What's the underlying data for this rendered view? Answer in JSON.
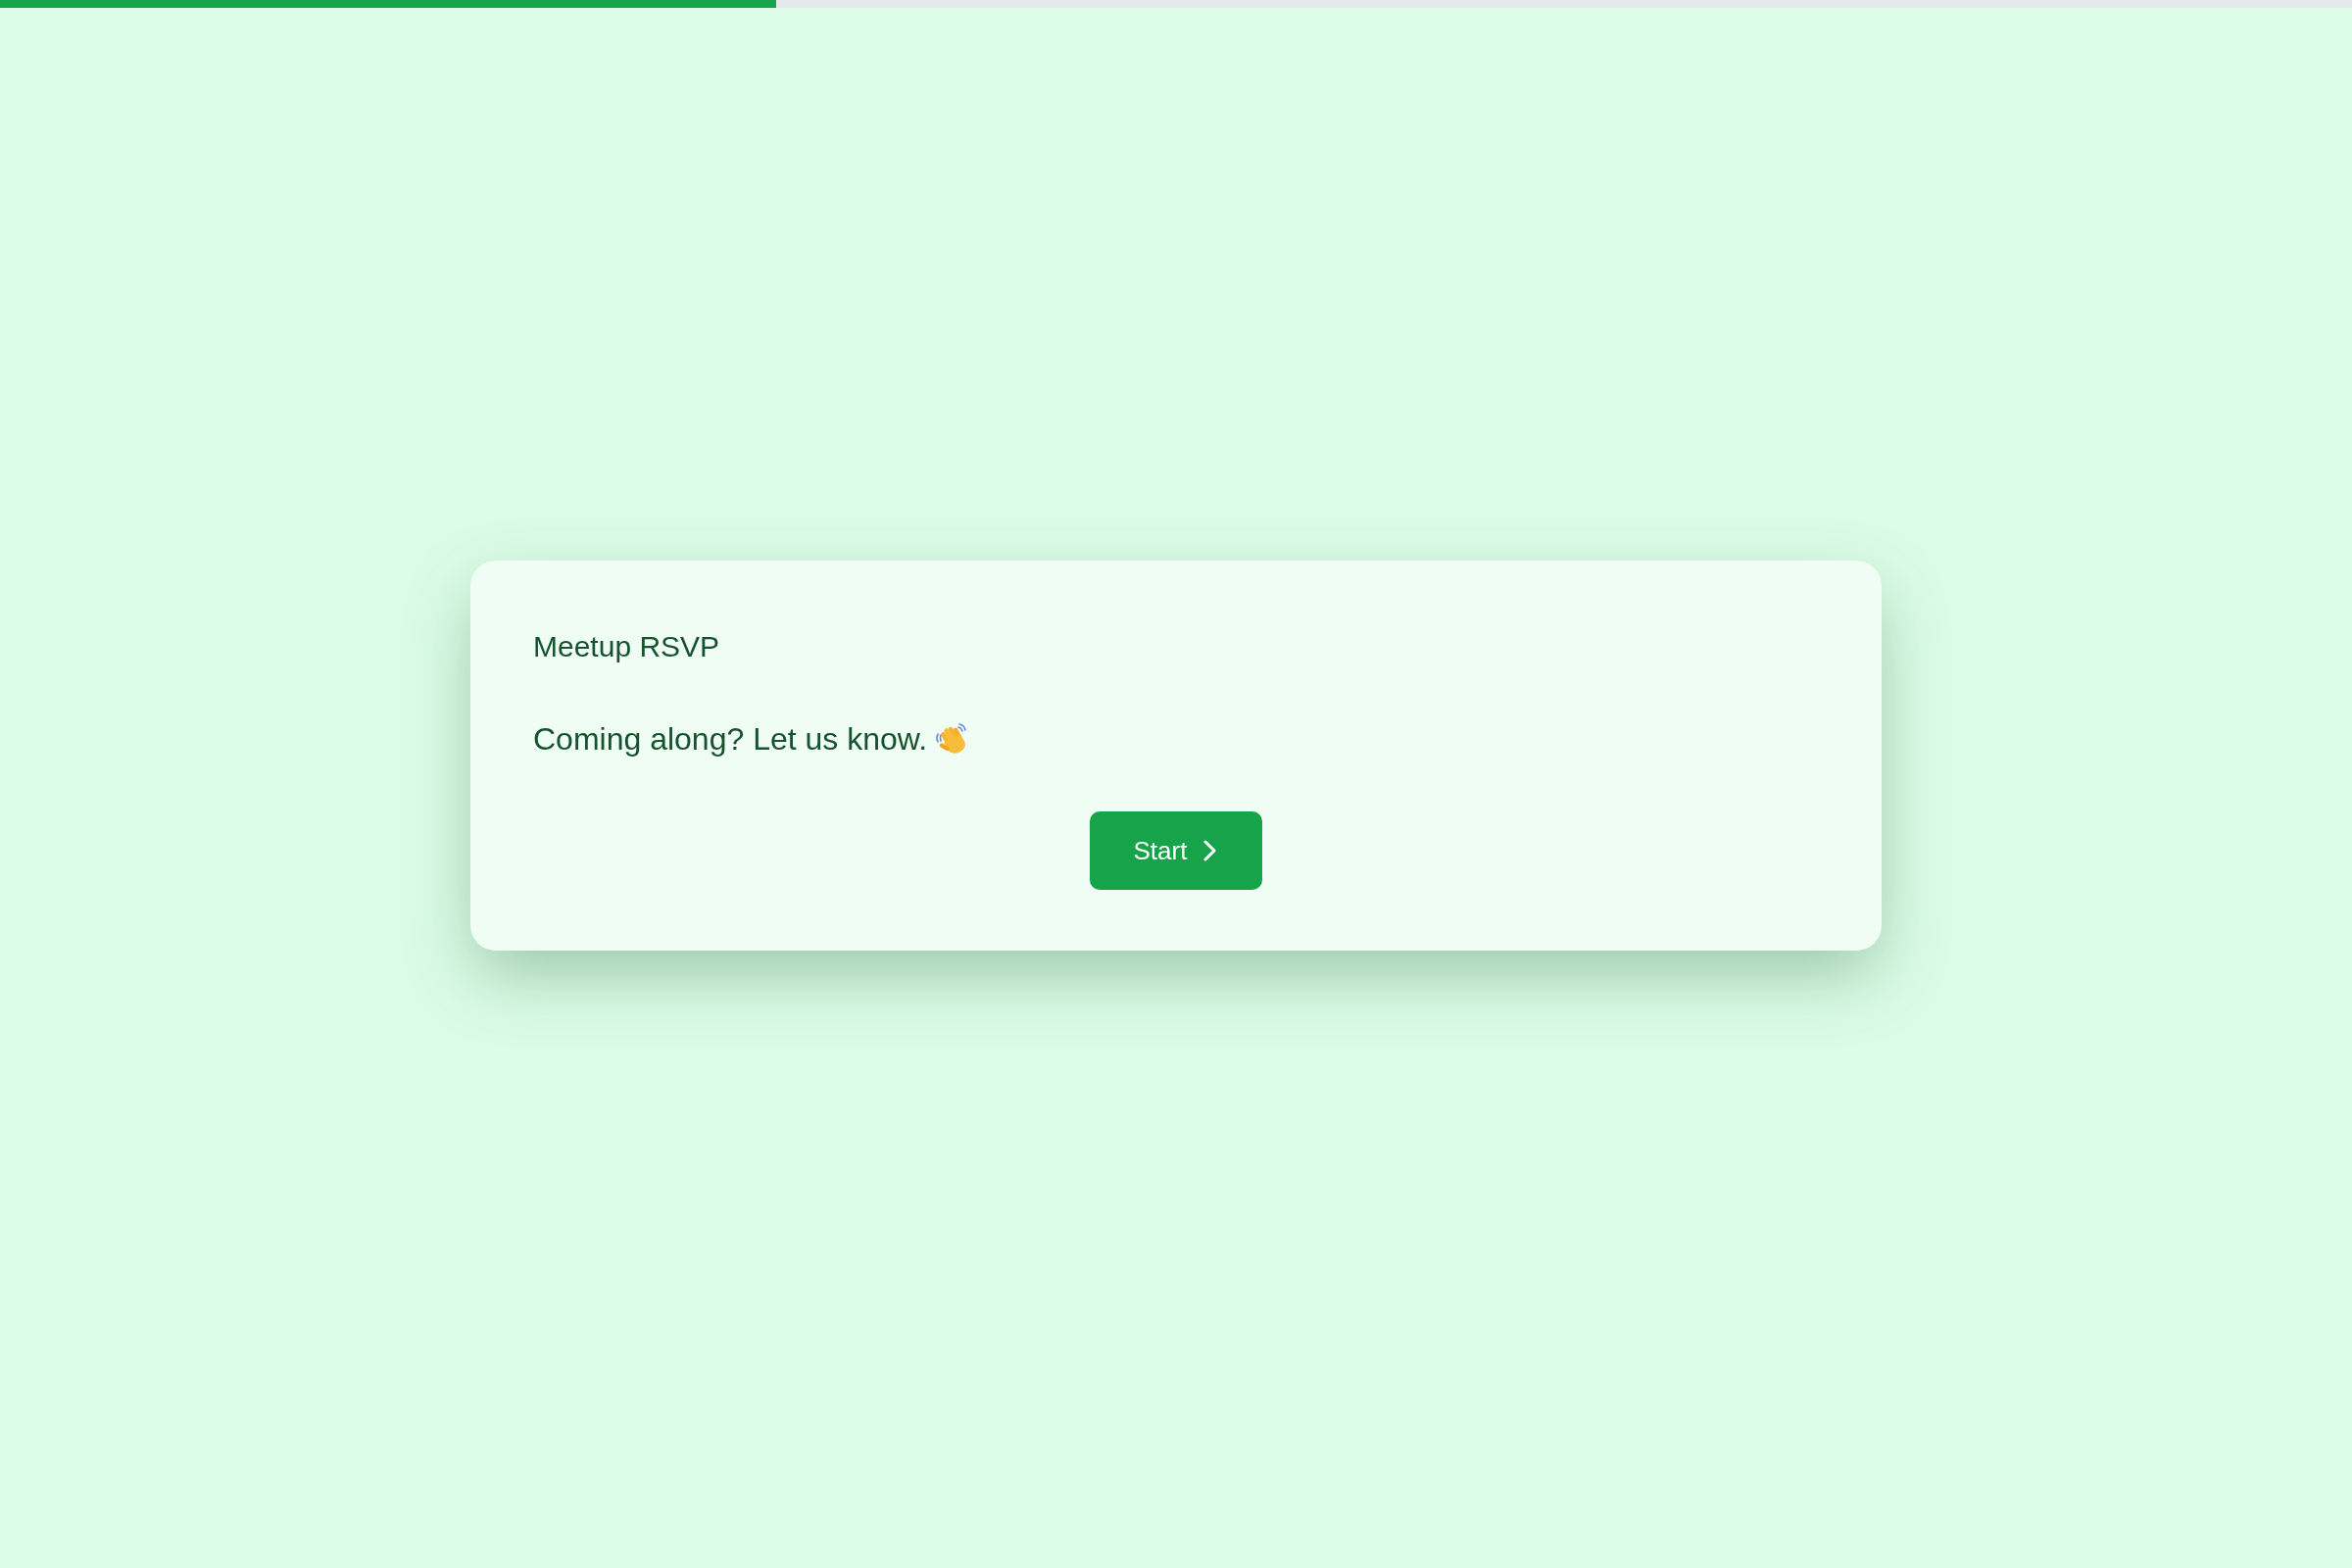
{
  "progress": {
    "level": 0.33
  },
  "card": {
    "title": "Meetup RSVP",
    "message": "Coming along? Let us know.",
    "button": {
      "label": "Start"
    }
  }
}
